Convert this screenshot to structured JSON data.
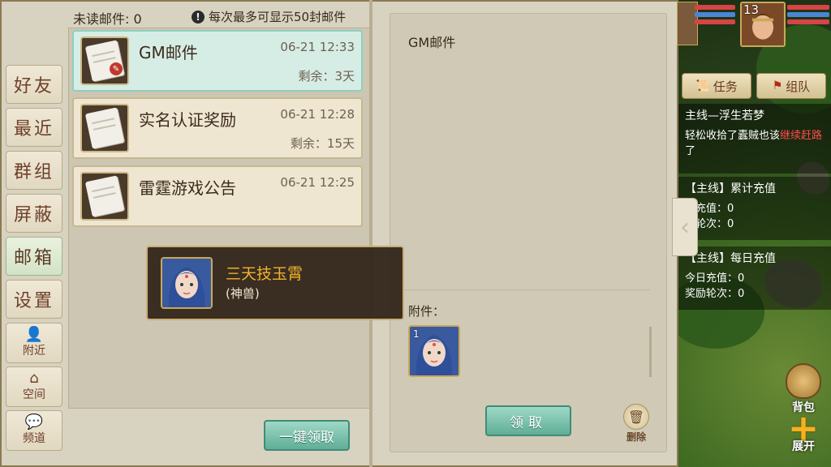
{
  "header": {
    "unread_label": "未读邮件: 0",
    "notice_text": "每次最多可显示50封邮件"
  },
  "tabs": [
    {
      "label": "好友"
    },
    {
      "label": "最近"
    },
    {
      "label": "群组"
    },
    {
      "label": "屏蔽"
    },
    {
      "label": "邮箱"
    },
    {
      "label": "设置"
    },
    {
      "label": "附近"
    },
    {
      "label": "空间"
    },
    {
      "label": "频道"
    }
  ],
  "mails": [
    {
      "subject": "GM邮件",
      "time": "06-21 12:33",
      "remain": "剩余：3天"
    },
    {
      "subject": "实名认证奖励",
      "time": "06-21 12:28",
      "remain": "剩余：15天"
    },
    {
      "subject": "雷霆游戏公告",
      "time": "06-21 12:25",
      "remain": ""
    }
  ],
  "tooltip": {
    "name": "三天技玉霄",
    "type": "(神兽)"
  },
  "detail": {
    "title": "GM邮件",
    "attach_label": "附件：",
    "item_count": "1",
    "receive_label": "领取",
    "delete_label": "删除"
  },
  "claim_all_label": "一键领取",
  "hud": {
    "level": "13",
    "task_label": "任务",
    "team_label": "组队",
    "quests": [
      {
        "title": "主线—浮生若梦",
        "line1": "轻松收拾了蠹贼也该",
        "line1_red": "继续赶路",
        "line1_end": "了"
      },
      {
        "title": "【主线】累计充值",
        "line1": "计充值：0",
        "line2": "励轮次：0"
      },
      {
        "title": "【主线】每日充值",
        "line1": "今日充值：0",
        "line2": "奖励轮次：0"
      }
    ],
    "bag_label": "背包",
    "expand_label": "展开"
  },
  "colors": {
    "accent_teal": "#5fae97",
    "tooltip_name": "#f0b32a",
    "quest_red": "#ff4c4c"
  }
}
